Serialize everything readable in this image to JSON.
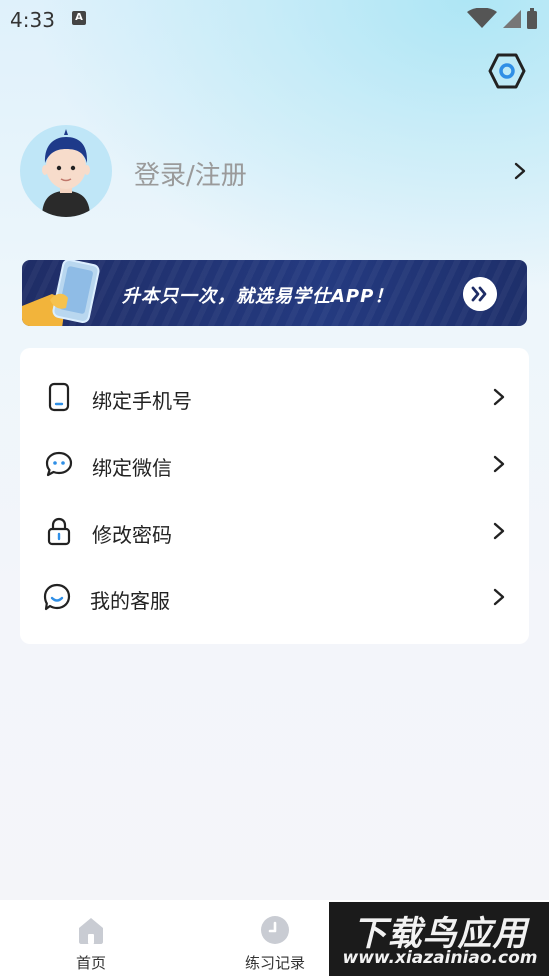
{
  "status_bar": {
    "time": "4:33",
    "notification_badge": "A"
  },
  "header": {
    "settings_icon": "settings-hexagon-icon"
  },
  "profile": {
    "login_label": "登录/注册",
    "avatar_icon": "user-avatar"
  },
  "banner": {
    "text": "升本只一次，就选易学仕APP！",
    "go_icon": "double-chevron-right-icon"
  },
  "menu": {
    "items": [
      {
        "label": "绑定手机号",
        "icon": "phone-icon"
      },
      {
        "label": "绑定微信",
        "icon": "chat-bubble-icon"
      },
      {
        "label": "修改密码",
        "icon": "lock-icon"
      },
      {
        "label": "我的客服",
        "icon": "customer-service-icon"
      }
    ]
  },
  "tabbar": {
    "tabs": [
      {
        "label": "首页",
        "icon": "home-icon"
      },
      {
        "label": "练习记录",
        "icon": "clock-icon"
      }
    ]
  },
  "watermark": {
    "main": "下载鸟应用",
    "sub": "www.xiazainiao.com"
  },
  "colors": {
    "accent": "#2f7fd6",
    "banner_bg": "#22347a",
    "page_bg": "#f4f5f9"
  }
}
